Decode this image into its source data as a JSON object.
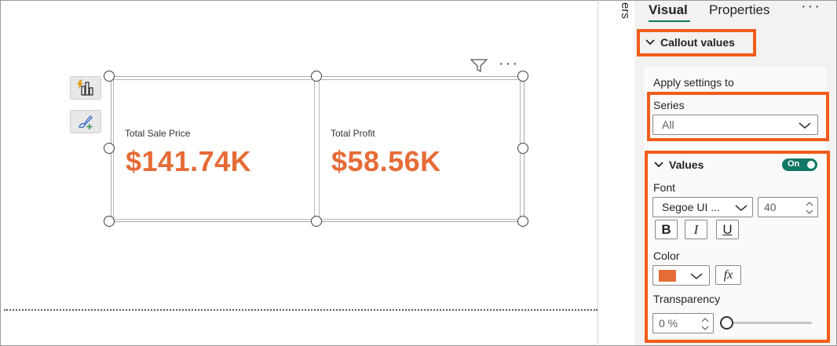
{
  "canvas": {
    "cards": [
      {
        "label": "Total Sale Price",
        "value": "$141.74K"
      },
      {
        "label": "Total Profit",
        "value": "$58.56K"
      }
    ]
  },
  "pane": {
    "strip_text": "ers",
    "tabs": [
      {
        "label": "Visual",
        "active": true
      },
      {
        "label": "Properties",
        "active": false
      }
    ],
    "more_label": "···",
    "callout_title": "Callout values",
    "apply_settings_label": "Apply settings to",
    "series_label": "Series",
    "series_value": "All",
    "values_title": "Values",
    "values_toggle": "On",
    "font_label": "Font",
    "font_family": "Segoe UI ...",
    "font_size": "40",
    "bold_label": "B",
    "italic_label": "I",
    "underline_label": "U",
    "color_label": "Color",
    "color_value": "#e66c37",
    "fx_label": "fx",
    "transparency_label": "Transparency",
    "transparency_value": "0 %",
    "transparency_level": 0
  },
  "colors": {
    "highlight": "#f25c19",
    "accent": "#117865",
    "callout": "#e66c37"
  }
}
